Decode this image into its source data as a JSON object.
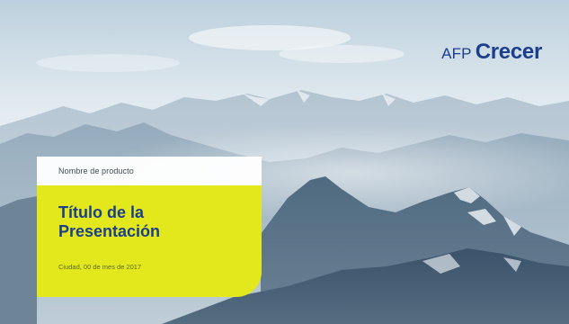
{
  "logo": {
    "afp": "AFP",
    "crecer": "Crecer",
    "color": "#1b3f8c"
  },
  "product": {
    "label": "Nombre de producto"
  },
  "title": {
    "line1": "Título de la",
    "line2": "Presentación",
    "color": "#1b3f8c",
    "box_color": "#e3e81d"
  },
  "date": {
    "text": "Ciudad, 00 de mes de 2017"
  }
}
